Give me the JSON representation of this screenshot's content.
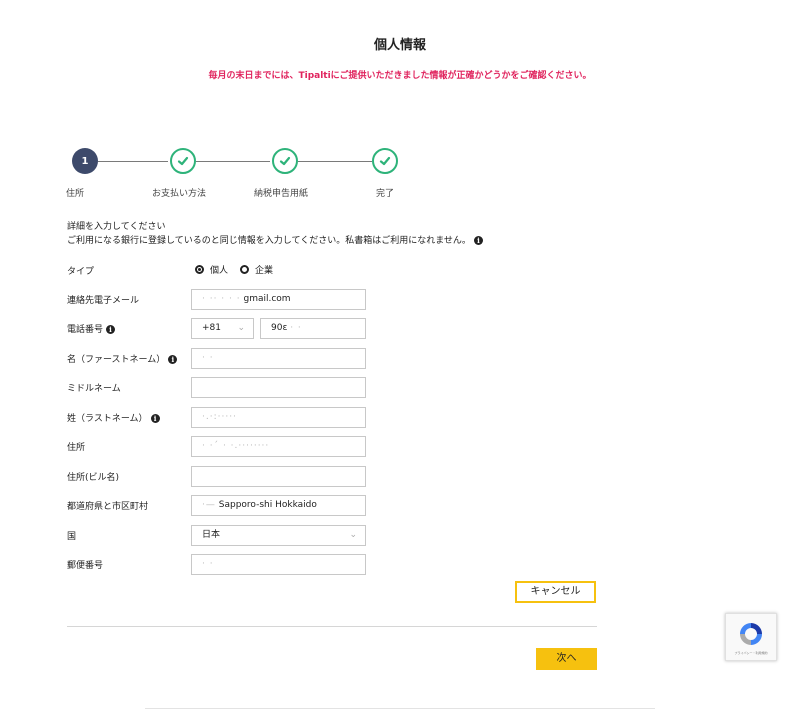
{
  "header": {
    "title": "個人情報",
    "notice": "毎月の末日までには、Tipaltiにご提供いただきました情報が正確かどうかをご確認ください。"
  },
  "stepper": {
    "current_number": "1",
    "steps": [
      {
        "label": "住所",
        "state": "current"
      },
      {
        "label": "お支払い方法",
        "state": "done"
      },
      {
        "label": "納税申告用紙",
        "state": "done"
      },
      {
        "label": "完了",
        "state": "done"
      }
    ]
  },
  "intro": {
    "line1": "詳細を入力してください",
    "line2": "ご利用になる銀行に登録しているのと同じ情報を入力してください。私書箱はご利用になれません。"
  },
  "form": {
    "type_label": "タイプ",
    "type_options": [
      {
        "label": "個人",
        "selected": true
      },
      {
        "label": "企業",
        "selected": false
      }
    ],
    "email_label": "連絡先電子メール",
    "email_value_hidden": "· ·· · · ·",
    "email_value": "gmail.com",
    "phone_label": "電話番号",
    "phone_code": "+81",
    "phone_number_value": "90ε",
    "phone_number_hidden": "·  ·",
    "first_name_label": "名（ファーストネーム）",
    "first_name_value": "·   ·",
    "middle_name_label": "ミドルネーム",
    "middle_name_value": "",
    "last_name_label": "姓（ラストネーム）",
    "last_name_value": "·.·:·····",
    "address_label": "住所",
    "address_value": "· ·´ · ·.········",
    "address2_label": "住所(ビル名)",
    "address2_value": "",
    "city_label": "都道府県と市区町村",
    "city_value_hidden": "·—",
    "city_value": "Sapporo-shi Hokkaido",
    "country_label": "国",
    "country_value": "日本",
    "postal_label": "郵便番号",
    "postal_value": "· ·"
  },
  "buttons": {
    "cancel": "キャンセル",
    "next": "次へ"
  },
  "colors": {
    "notice": "#e0245e",
    "accent_yellow": "#f6c10f",
    "step_current": "#3d4a6b",
    "step_done": "#2eb37a"
  }
}
